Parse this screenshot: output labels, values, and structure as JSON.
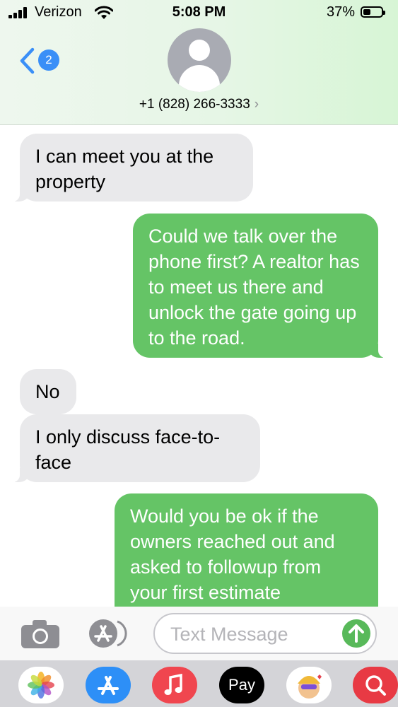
{
  "status_bar": {
    "carrier": "Verizon",
    "time": "5:08 PM",
    "battery_percent": "37%",
    "battery_level": 0.37
  },
  "header": {
    "back_badge": "2",
    "contact": "+1 (828) 266-3333",
    "chevron": "›"
  },
  "messages": [
    {
      "direction": "incoming",
      "text": "I can meet you at the property"
    },
    {
      "direction": "outgoing",
      "text": "Could we talk over the phone first? A realtor has to meet us there and unlock the gate going up to the road."
    },
    {
      "direction": "incoming",
      "text": "No"
    },
    {
      "direction": "incoming",
      "text": "I only discuss face-to-face"
    },
    {
      "direction": "outgoing",
      "text": "Would you be ok if the owners reached out and asked to followup from your first estimate"
    }
  ],
  "input_bar": {
    "placeholder": "Text Message"
  },
  "app_drawer": {
    "apps": [
      {
        "name": "photos-app-icon"
      },
      {
        "name": "app-store-icon"
      },
      {
        "name": "music-icon"
      },
      {
        "name": "apple-pay-icon",
        "label": "Pay"
      },
      {
        "name": "memoji-icon"
      },
      {
        "name": "web-search-icon"
      }
    ]
  },
  "colors": {
    "outgoing_bubble": "#65c466",
    "incoming_bubble": "#e9e9eb",
    "accent": "#3a8ff7"
  }
}
